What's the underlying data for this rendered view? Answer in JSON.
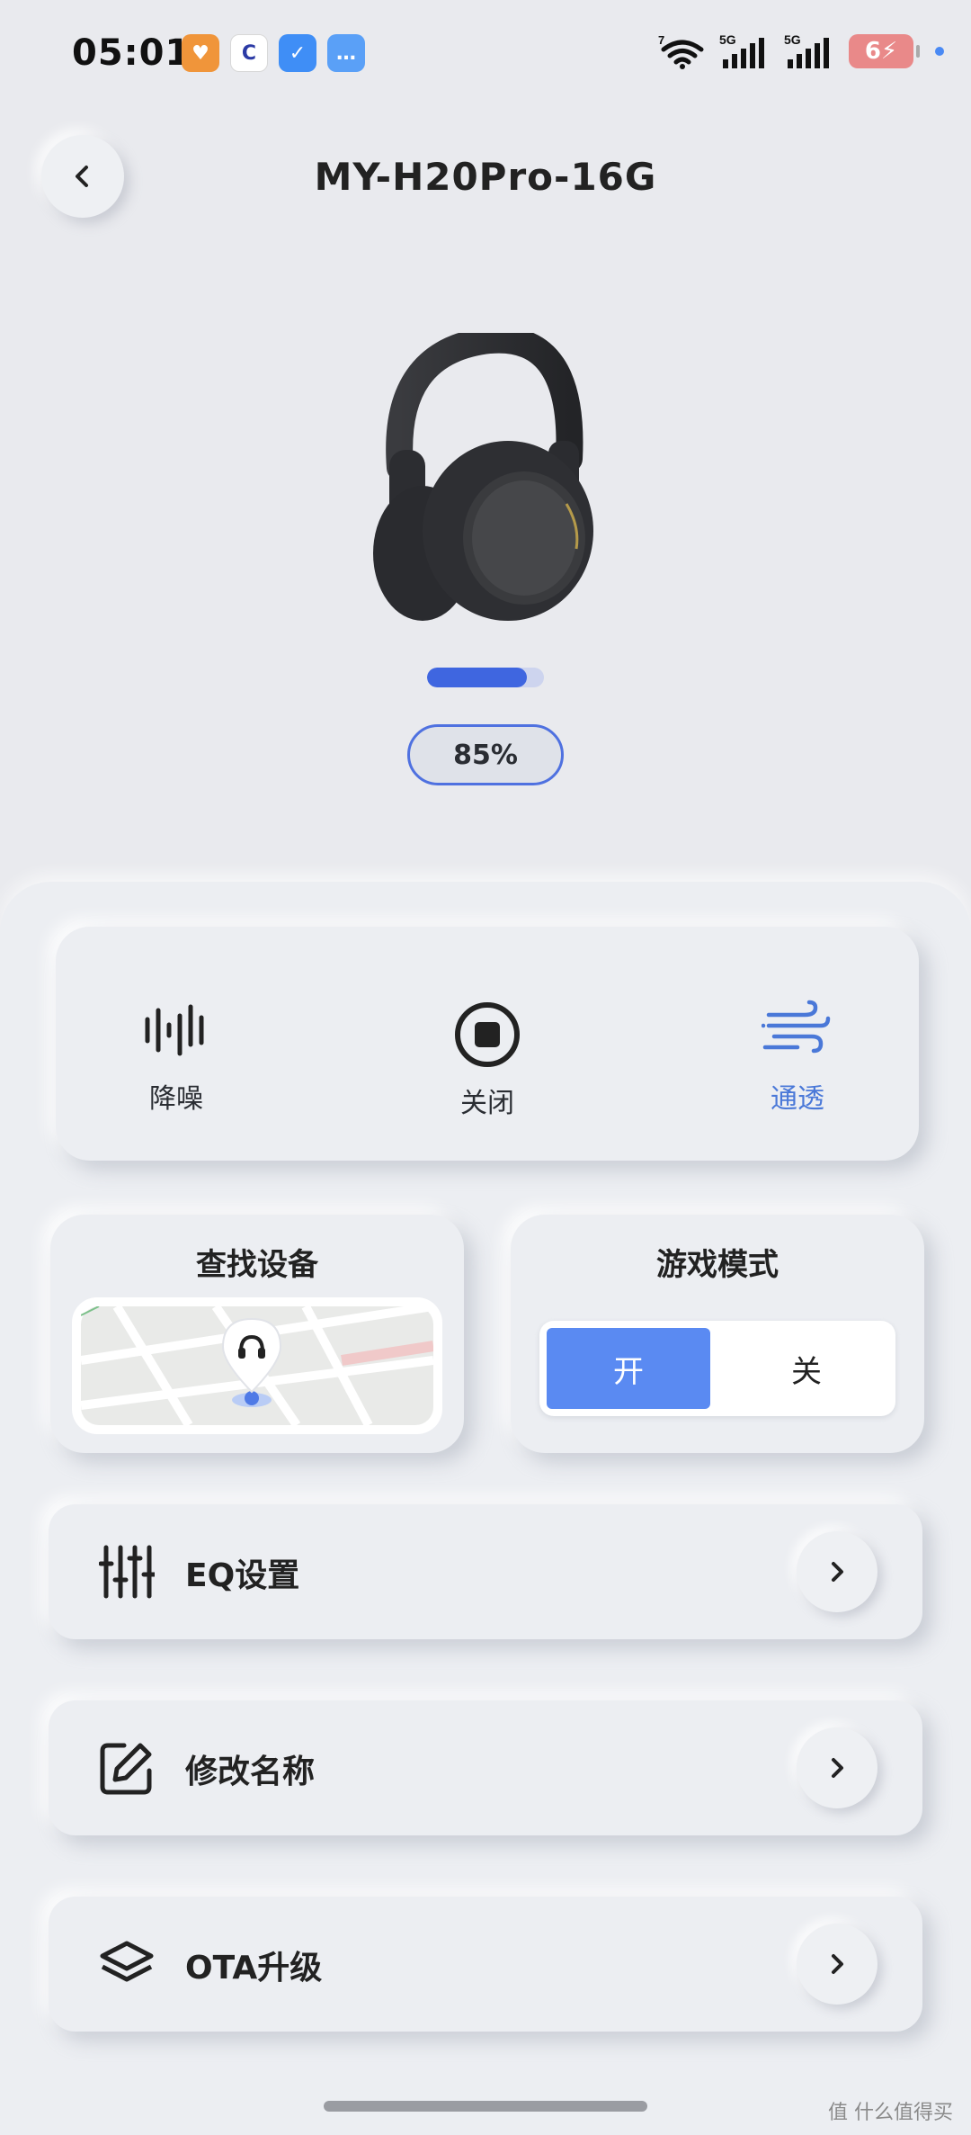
{
  "status": {
    "time": "05:01",
    "apps": [
      "heart-app",
      "c-app",
      "shield-app",
      "message-app"
    ],
    "battery": "6",
    "network": [
      "5G",
      "5G"
    ]
  },
  "header": {
    "title": "MY-H20Pro-16G"
  },
  "device": {
    "battery_percent_label": "85%",
    "battery_level": 0.85
  },
  "modes": [
    {
      "label": "降噪",
      "icon": "noise-cancel-icon",
      "active": false
    },
    {
      "label": "关闭",
      "icon": "stop-circle-icon",
      "active": false
    },
    {
      "label": "通透",
      "icon": "wind-icon",
      "active": true
    }
  ],
  "find_device": {
    "title": "查找设备"
  },
  "game_mode": {
    "title": "游戏模式",
    "on_label": "开",
    "off_label": "关",
    "selected": "on"
  },
  "menu": [
    {
      "label": "EQ设置",
      "icon": "equalizer-icon"
    },
    {
      "label": "修改名称",
      "icon": "edit-icon"
    },
    {
      "label": "OTA升级",
      "icon": "layers-icon"
    }
  ],
  "colors": {
    "accent": "#4a78d8",
    "toggle_on": "#5a8af2",
    "battery": "#3f66e0",
    "background": "#e9eaee"
  },
  "watermark": "值 什么值得买"
}
